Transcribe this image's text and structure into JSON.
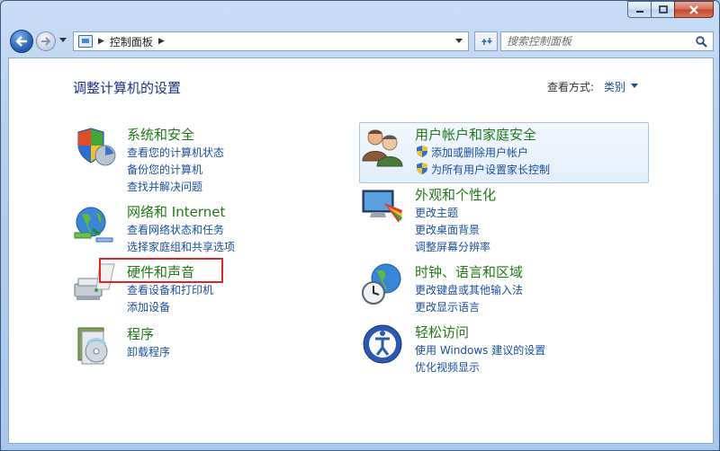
{
  "window": {
    "breadcrumb": [
      "控制面板"
    ],
    "search_placeholder": "搜索控制面板"
  },
  "main": {
    "title": "调整计算机的设置",
    "view_by_label": "查看方式:",
    "view_by_value": "类别"
  },
  "categories": [
    {
      "title": "系统和安全",
      "icon": "system-security-icon",
      "links": [
        "查看您的计算机状态",
        "备份您的计算机",
        "查找并解决问题"
      ]
    },
    {
      "title": "网络和 Internet",
      "icon": "network-internet-icon",
      "links": [
        "查看网络状态和任务",
        "选择家庭组和共享选项"
      ]
    },
    {
      "title": "硬件和声音",
      "icon": "hardware-sound-icon",
      "links": [
        "查看设备和打印机",
        "添加设备"
      ]
    },
    {
      "title": "程序",
      "icon": "programs-icon",
      "links": [
        "卸载程序"
      ]
    },
    {
      "title": "用户帐户和家庭安全",
      "icon": "user-accounts-icon",
      "links": [
        "添加或删除用户帐户",
        "为所有用户设置家长控制"
      ]
    },
    {
      "title": "外观和个性化",
      "icon": "appearance-icon",
      "links": [
        "更改主题",
        "更改桌面背景",
        "调整屏幕分辨率"
      ]
    },
    {
      "title": "时钟、语言和区域",
      "icon": "clock-language-icon",
      "links": [
        "更改键盘或其他输入法",
        "更改显示语言"
      ]
    },
    {
      "title": "轻松访问",
      "icon": "ease-of-access-icon",
      "links": [
        "使用 Windows 建议的设置",
        "优化视频显示"
      ]
    }
  ],
  "colors": {
    "title_green": "#1f7a15",
    "link_blue": "#1a4fa0",
    "highlight_red": "#e02525"
  }
}
